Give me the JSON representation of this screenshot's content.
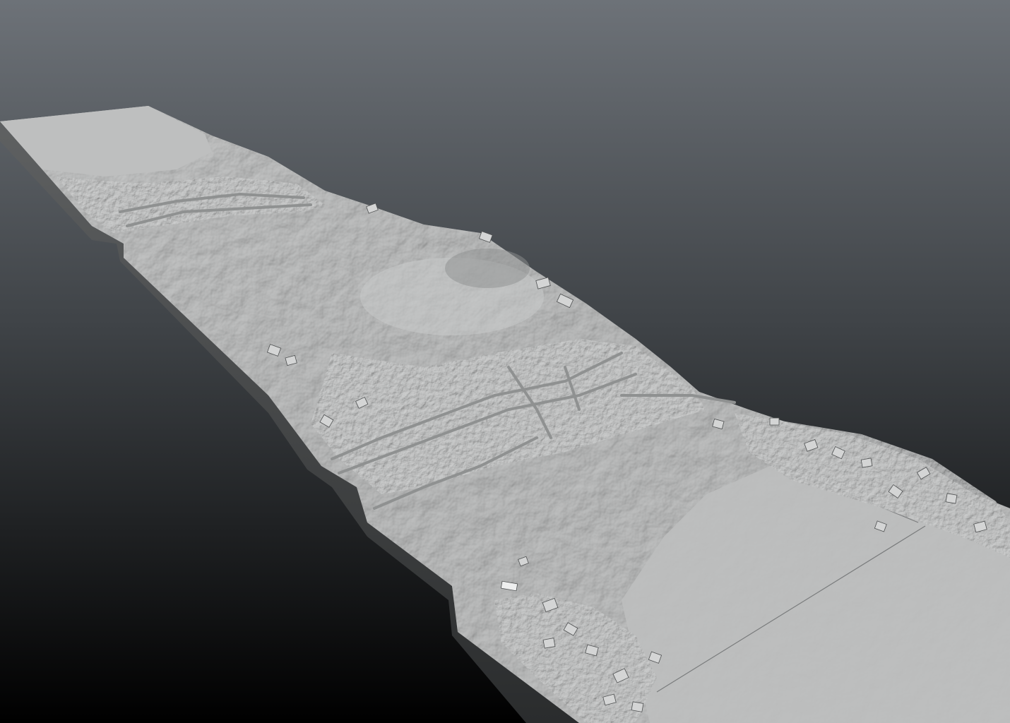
{
  "viewport": {
    "background_top": "#6d7278",
    "background_bottom": "#000000"
  },
  "model": {
    "kind": "terrain-mesh",
    "surface_color": "#b8b9b9",
    "highlight_color": "#d6d7d7",
    "shadow_color": "#6a6c6d",
    "edge_color": "#3c3e40"
  }
}
